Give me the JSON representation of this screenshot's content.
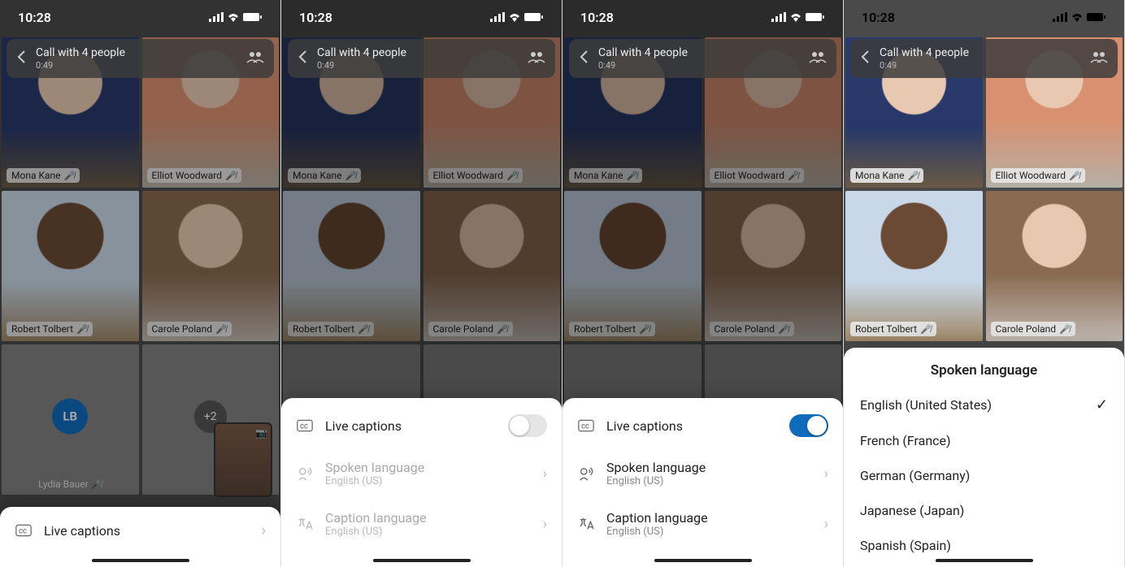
{
  "status": {
    "time": "10:28"
  },
  "call": {
    "title": "Call with 4 people",
    "duration": "0:49"
  },
  "participants": [
    {
      "name": "Mona Kane",
      "muted": true
    },
    {
      "name": "Elliot Woodward",
      "muted": true
    },
    {
      "name": "Robert Tolbert",
      "muted": true
    },
    {
      "name": "Carole Poland",
      "muted": true
    }
  ],
  "extra": {
    "initials": "LB",
    "name": "Lydia Bauer",
    "overflow": "+2"
  },
  "captions": {
    "label": "Live captions",
    "spoken": {
      "title": "Spoken language",
      "value": "English (US)"
    },
    "caption": {
      "title": "Caption language",
      "value": "English (US)"
    }
  },
  "language_sheet": {
    "title": "Spoken language",
    "options": [
      {
        "label": "English (United States)",
        "selected": true
      },
      {
        "label": "French (France)",
        "selected": false
      },
      {
        "label": "German (Germany)",
        "selected": false
      },
      {
        "label": "Japanese (Japan)",
        "selected": false
      },
      {
        "label": "Spanish (Spain)",
        "selected": false
      }
    ]
  }
}
